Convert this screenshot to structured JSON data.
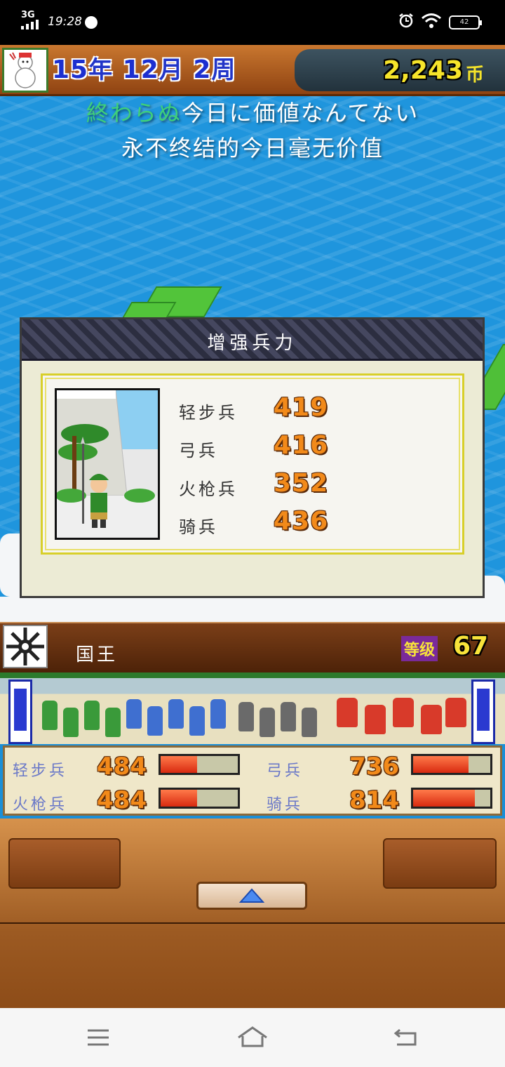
{
  "status_bar": {
    "network": "3G",
    "time": "19:28",
    "battery": "42"
  },
  "header": {
    "year": "15",
    "year_unit": "年",
    "month": "12",
    "month_unit": "月",
    "week": "2",
    "week_unit": "周",
    "money": "2,243",
    "money_unit": "币"
  },
  "lyrics": {
    "line1_highlight": "終わらぬ",
    "line1_rest": "今日に価値なんてない",
    "line2": "永不终结的今日毫无价值"
  },
  "dialog": {
    "title": "增强兵力",
    "stats": [
      {
        "label": "轻步兵",
        "value": "419"
      },
      {
        "label": "弓兵",
        "value": "416"
      },
      {
        "label": "火枪兵",
        "value": "352"
      },
      {
        "label": "骑兵",
        "value": "436"
      }
    ]
  },
  "lord": {
    "title": "国王",
    "level_label": "等级",
    "level": "67"
  },
  "totals": [
    {
      "label": "轻步兵",
      "value": "484",
      "gauge": 0.47
    },
    {
      "label": "弓兵",
      "value": "736",
      "gauge": 0.72
    },
    {
      "label": "火枪兵",
      "value": "484",
      "gauge": 0.47
    },
    {
      "label": "骑兵",
      "value": "814",
      "gauge": 0.8
    }
  ],
  "colors": {
    "accent_orange": "#f28a1a",
    "date_blue": "#1c2fd0",
    "money_yellow": "#f6e42a",
    "gauge_red": "#e03a1a"
  },
  "icons": {
    "up_arrow": "up-arrow-icon",
    "nav_menu": "menu-icon",
    "nav_home": "home-icon",
    "nav_back": "back-icon"
  }
}
